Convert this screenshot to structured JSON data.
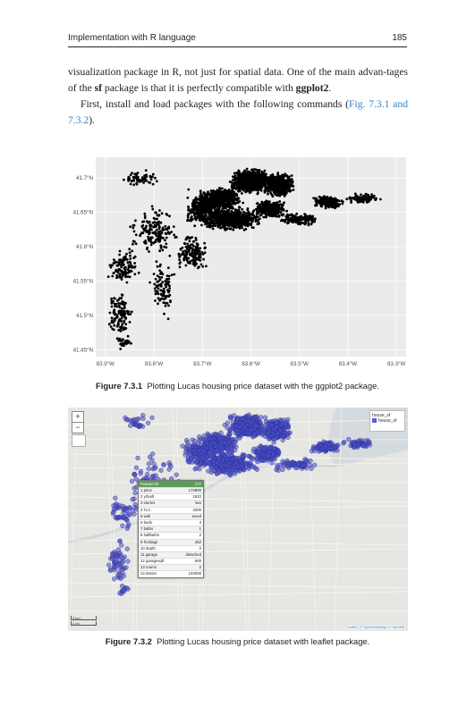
{
  "header": {
    "left": "Implementation with R language",
    "page": "185"
  },
  "body": {
    "p1_a": "visualization package in R, not just for spatial data. One of the main advan-tages of the ",
    "p1_b": "sf",
    "p1_c": " package is that it is perfectly compatible with ",
    "p1_d": "ggplot2",
    "p1_e": ".",
    "p2_a": "First, install and load packages with the following commands (",
    "p2_ref": "Fig. 7.3.1 and 7.3.2",
    "p2_b": ")."
  },
  "figure1": {
    "label": "Figure 7.3.1",
    "caption": "Plotting Lucas housing price dataset with the ggplot2 package.",
    "chart_data": {
      "type": "scatter",
      "title": "",
      "xlabel": "",
      "ylabel": "",
      "xlim": [
        -83.92,
        -83.28
      ],
      "ylim": [
        41.44,
        41.73
      ],
      "x_ticks": [
        "83.9°W",
        "83.8°W",
        "83.7°W",
        "83.6°W",
        "83.5°W",
        "83.4°W",
        "83.3°W"
      ],
      "y_ticks": [
        "41.7°N",
        "41.65°N",
        "41.6°N",
        "41.55°N",
        "41.5°N",
        "41.45°N"
      ],
      "grid": true,
      "background": "#ebebeb",
      "point_color": "#000000"
    }
  },
  "figure2": {
    "label": "Figure 7.3.2",
    "caption": "Plotting Lucas housing price dataset with leaflet package.",
    "zoom_in": "+",
    "zoom_out": "−",
    "legend": {
      "title": "house_sf",
      "item": "house_sf",
      "color": "#5a5ee0"
    },
    "point_color": "#4a4ec8",
    "popup": {
      "header": [
        "Feature ID",
        "177"
      ],
      "rows": [
        [
          "1 price",
          "173800"
        ],
        [
          "2 yrbuilt",
          "1922"
        ],
        [
          "3 stories",
          "two"
        ],
        [
          "4 TLA",
          "2000"
        ],
        [
          "5 wall",
          "wood"
        ],
        [
          "6 beds",
          "3"
        ],
        [
          "7 baths",
          "1"
        ],
        [
          "8 halfbaths",
          "2"
        ],
        [
          "9 frontage",
          "252"
        ],
        [
          "10 depth",
          "0"
        ],
        [
          "11 garage",
          "detached"
        ],
        [
          "12 garagesqft",
          "500"
        ],
        [
          "13 rooms",
          "2"
        ],
        [
          "14 lotsize",
          "133000"
        ]
      ]
    },
    "scale": {
      "km": "3 km",
      "mi": "2 mi"
    },
    "attribution": "Leaflet | © OpenStreetMap © CartoDB"
  }
}
